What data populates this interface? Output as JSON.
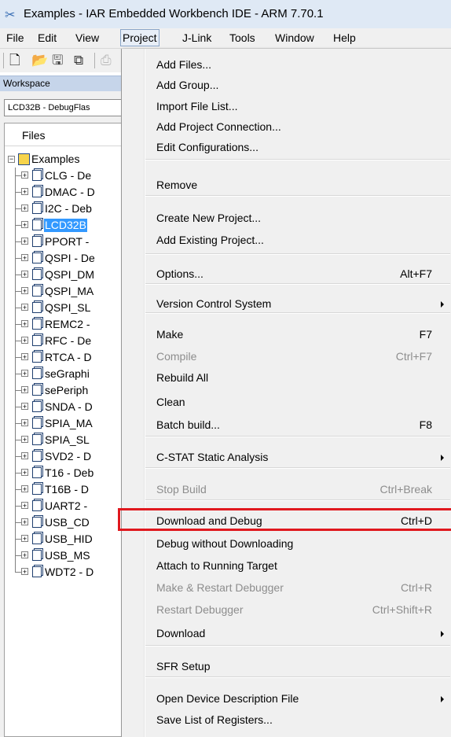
{
  "window": {
    "title": "Examples - IAR Embedded Workbench IDE - ARM 7.70.1",
    "icon": "iar-tools-icon"
  },
  "menubar": {
    "items": [
      "File",
      "Edit",
      "View",
      "Project",
      "J-Link",
      "Tools",
      "Window",
      "Help"
    ],
    "active": "Project"
  },
  "workspace": {
    "header": "Workspace",
    "configuration": "LCD32B - DebugFlas",
    "files_header": "Files",
    "root": "Examples",
    "projects": [
      "CLG - De",
      "DMAC - D",
      "I2C - Deb",
      "LCD32B",
      "PPORT -",
      "QSPI - De",
      "QSPI_DM",
      "QSPI_MA",
      "QSPI_SL",
      "REMC2 -",
      "RFC - De",
      "RTCA - D",
      "seGraphi",
      "sePeriph",
      "SNDA - D",
      "SPIA_MA",
      "SPIA_SL",
      "SVD2 - D",
      "T16 - Deb",
      "T16B - D",
      "UART2 -",
      "USB_CD",
      "USB_HID",
      "USB_MS",
      "WDT2 - D"
    ],
    "selected": "LCD32B"
  },
  "project_menu": {
    "items": [
      {
        "label": "Add Files...",
        "shortcut": "",
        "disabled": false,
        "submenu": false
      },
      {
        "label": "Add Group...",
        "shortcut": "",
        "disabled": false,
        "submenu": false
      },
      {
        "label": "Import File List...",
        "shortcut": "",
        "disabled": false,
        "submenu": false
      },
      {
        "label": "Add Project Connection...",
        "shortcut": "",
        "disabled": false,
        "submenu": false
      },
      {
        "label": "Edit Configurations...",
        "shortcut": "",
        "disabled": false,
        "submenu": false
      },
      {
        "label": "Remove",
        "shortcut": "",
        "disabled": false,
        "submenu": false
      },
      {
        "label": "Create New Project...",
        "shortcut": "",
        "disabled": false,
        "submenu": false
      },
      {
        "label": "Add Existing Project...",
        "shortcut": "",
        "disabled": false,
        "submenu": false
      },
      {
        "label": "Options...",
        "shortcut": "Alt+F7",
        "disabled": false,
        "submenu": false
      },
      {
        "label": "Version Control System",
        "shortcut": "",
        "disabled": false,
        "submenu": true
      },
      {
        "label": "Make",
        "shortcut": "F7",
        "disabled": false,
        "submenu": false
      },
      {
        "label": "Compile",
        "shortcut": "Ctrl+F7",
        "disabled": true,
        "submenu": false
      },
      {
        "label": "Rebuild All",
        "shortcut": "",
        "disabled": false,
        "submenu": false
      },
      {
        "label": "Clean",
        "shortcut": "",
        "disabled": false,
        "submenu": false
      },
      {
        "label": "Batch build...",
        "shortcut": "F8",
        "disabled": false,
        "submenu": false
      },
      {
        "label": "C-STAT Static Analysis",
        "shortcut": "",
        "disabled": false,
        "submenu": true
      },
      {
        "label": "Stop Build",
        "shortcut": "Ctrl+Break",
        "disabled": true,
        "submenu": false
      },
      {
        "label": "Download and Debug",
        "shortcut": "Ctrl+D",
        "disabled": false,
        "submenu": false
      },
      {
        "label": "Debug without Downloading",
        "shortcut": "",
        "disabled": false,
        "submenu": false
      },
      {
        "label": "Attach to Running Target",
        "shortcut": "",
        "disabled": false,
        "submenu": false
      },
      {
        "label": "Make & Restart Debugger",
        "shortcut": "Ctrl+R",
        "disabled": true,
        "submenu": false
      },
      {
        "label": "Restart Debugger",
        "shortcut": "Ctrl+Shift+R",
        "disabled": true,
        "submenu": false
      },
      {
        "label": "Download",
        "shortcut": "",
        "disabled": false,
        "submenu": true
      },
      {
        "label": "SFR Setup",
        "shortcut": "",
        "disabled": false,
        "submenu": false
      },
      {
        "label": "Open Device Description File",
        "shortcut": "",
        "disabled": false,
        "submenu": true
      },
      {
        "label": "Save List of Registers...",
        "shortcut": "",
        "disabled": false,
        "submenu": false
      }
    ],
    "highlighted": "Download and Debug",
    "highlight_color": "#e0181e"
  }
}
